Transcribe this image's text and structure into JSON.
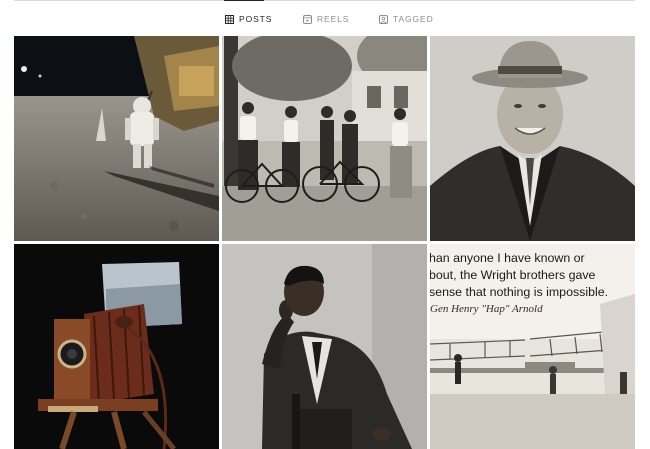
{
  "tabs": [
    {
      "label": "POSTS",
      "icon": "grid-icon",
      "active": true
    },
    {
      "label": "REELS",
      "icon": "reels-icon",
      "active": false
    },
    {
      "label": "TAGGED",
      "icon": "tagged-icon",
      "active": false
    }
  ],
  "posts": [
    {
      "subject": "astronaut-moon-landing"
    },
    {
      "subject": "women-with-bicycles"
    },
    {
      "subject": "man-in-hat-portrait"
    },
    {
      "subject": "vintage-bellows-camera"
    },
    {
      "subject": "seated-man-portrait"
    },
    {
      "subject": "wright-brothers-quote",
      "quote_lines": [
        "han anyone I have known or",
        "bout, the Wright brothers gave",
        "sense that nothing is impossible."
      ],
      "signature": "Gen Henry \"Hap\" Arnold"
    }
  ],
  "colors": {
    "active_tab": "#262626",
    "inactive_tab": "#8e8e8e",
    "divider": "#dbdbdb"
  }
}
